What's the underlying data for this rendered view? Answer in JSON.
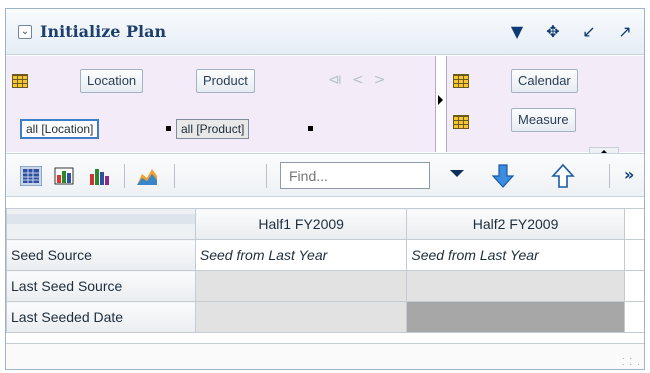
{
  "panel": {
    "title": "Initialize Plan",
    "title_icons": [
      "dropdown-icon",
      "move-icon",
      "minimize-icon",
      "expand-icon"
    ]
  },
  "layout": {
    "left": {
      "tiles": [
        "Location",
        "Product"
      ],
      "filters": [
        "all [Location]",
        "all [Product]"
      ]
    },
    "right": {
      "tiles": [
        "Calendar",
        "Measure"
      ]
    }
  },
  "toolbar": {
    "find_placeholder": "Find...",
    "more_label": "»"
  },
  "grid": {
    "columns": [
      "Half1 FY2009",
      "Half2 FY2009"
    ],
    "rows": [
      {
        "label": "Seed Source",
        "cells": [
          "Seed from Last Year",
          "Seed from Last Year"
        ]
      },
      {
        "label": "Last Seed Source",
        "cells": [
          "",
          ""
        ]
      },
      {
        "label": "Last Seeded Date",
        "cells": [
          "",
          ""
        ]
      }
    ]
  },
  "colors": {
    "pivot_region": "#f3ebf8",
    "accent": "#0f3a73",
    "cell_light_gray": "#e2e2e2",
    "cell_dark_gray": "#a7a7a7"
  }
}
